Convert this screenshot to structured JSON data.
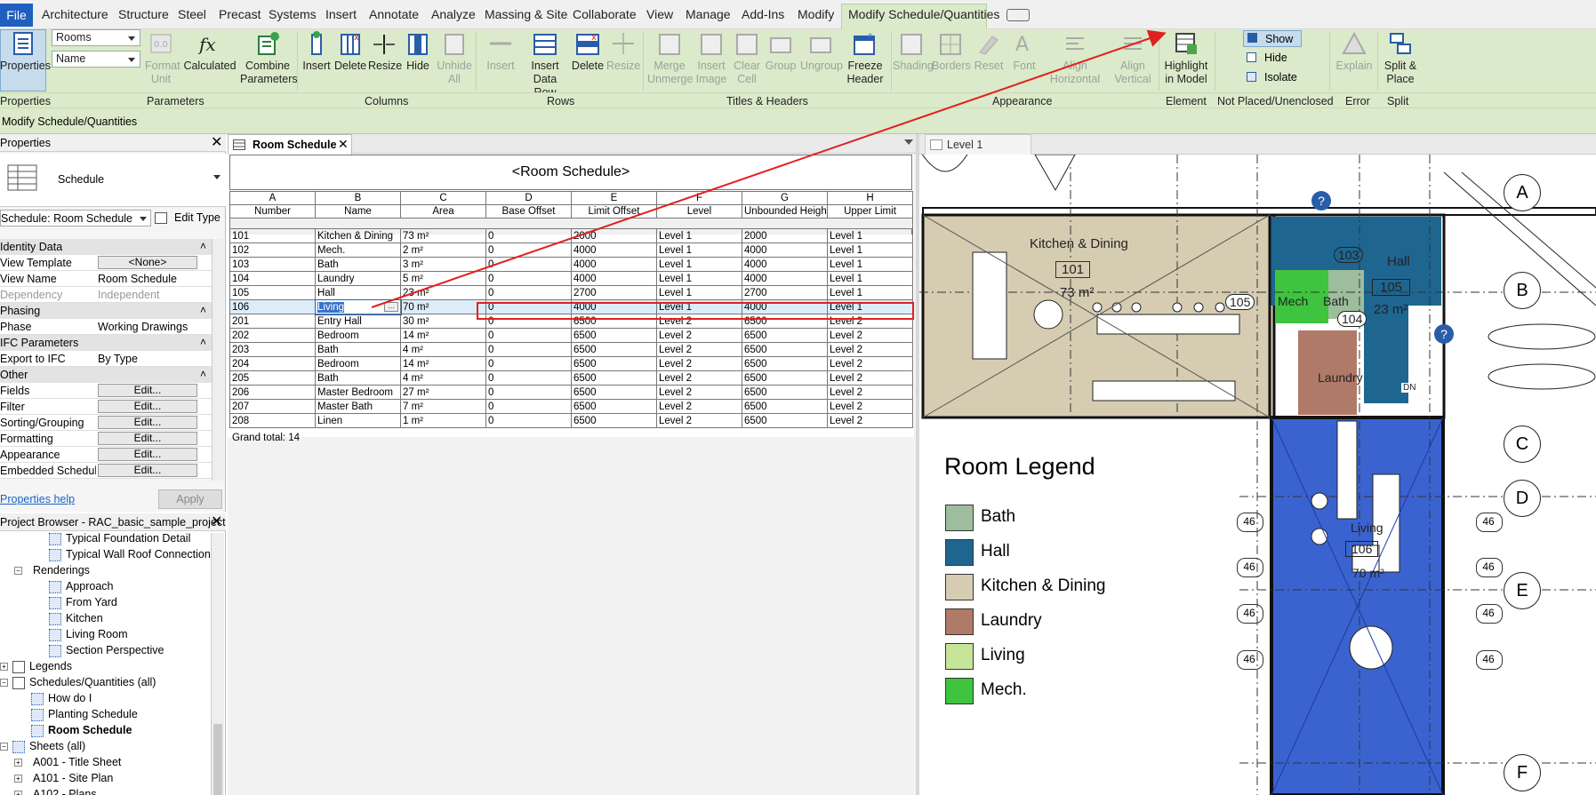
{
  "ribbon": {
    "tabs": [
      "File",
      "Architecture",
      "Structure",
      "Steel",
      "Precast",
      "Systems",
      "Insert",
      "Annotate",
      "Analyze",
      "Massing & Site",
      "Collaborate",
      "View",
      "Manage",
      "Add-Ins",
      "Modify",
      "Modify Schedule/Quantities"
    ],
    "active_tab": "Modify Schedule/Quantities",
    "category_combo": "Rooms",
    "field_combo": "Name",
    "buttons": {
      "properties": "Properties",
      "format_unit": "Format Unit",
      "calculated": "Calculated",
      "combine_parameters": "Combine Parameters",
      "insert_col": "Insert",
      "delete_col": "Delete",
      "resize_col": "Resize",
      "hide_col": "Hide",
      "unhide_all": "Unhide All",
      "insert_row": "Insert",
      "insert_data_row": "Insert Data Row",
      "delete_row": "Delete",
      "resize_row": "Resize",
      "merge_unmerge": "Merge Unmerge",
      "insert_image": "Insert Image",
      "clear_cell": "Clear Cell",
      "group": "Group",
      "ungroup": "Ungroup",
      "freeze_header": "Freeze Header",
      "shading": "Shading",
      "borders": "Borders",
      "reset": "Reset",
      "font": "Font",
      "align_horizontal": "Align Horizontal",
      "align_vertical": "Align Vertical",
      "highlight_in_model": "Highlight in Model",
      "show": "Show",
      "hide": "Hide",
      "isolate": "Isolate",
      "explain": "Explain",
      "split_place": "Split & Place"
    },
    "panels": [
      "Properties",
      "Parameters",
      "Columns",
      "Rows",
      "Titles & Headers",
      "Appearance",
      "Element",
      "Not Placed/Unenclosed",
      "Error",
      "Split"
    ]
  },
  "options_bar": "Modify Schedule/Quantities",
  "properties": {
    "title": "Properties",
    "type_name": "Schedule",
    "instance_selector": "Schedule: Room Schedule",
    "edit_type": "Edit Type",
    "groups": {
      "identity": "Identity Data",
      "phasing": "Phasing",
      "ifc": "IFC Parameters",
      "other": "Other"
    },
    "rows": {
      "view_template": {
        "k": "View Template",
        "v": "<None>"
      },
      "view_name": {
        "k": "View Name",
        "v": "Room Schedule"
      },
      "dependency": {
        "k": "Dependency",
        "v": "Independent"
      },
      "phase": {
        "k": "Phase",
        "v": "Working Drawings"
      },
      "export_ifc": {
        "k": "Export to IFC",
        "v": "By Type"
      },
      "fields": {
        "k": "Fields",
        "v": "Edit..."
      },
      "filter": {
        "k": "Filter",
        "v": "Edit..."
      },
      "sorting": {
        "k": "Sorting/Grouping",
        "v": "Edit..."
      },
      "formatting": {
        "k": "Formatting",
        "v": "Edit..."
      },
      "appearance": {
        "k": "Appearance",
        "v": "Edit..."
      },
      "embedded": {
        "k": "Embedded Schedule",
        "v": "Edit..."
      }
    },
    "help_link": "Properties help",
    "apply": "Apply"
  },
  "browser": {
    "title": "Project Browser - RAC_basic_sample_project",
    "items": [
      "Typical Foundation Detail",
      "Typical Wall Roof Connection",
      "Renderings",
      "Approach",
      "From Yard",
      "Kitchen",
      "Living Room",
      "Section Perspective",
      "Legends",
      "Schedules/Quantities (all)",
      "How do I",
      "Planting Schedule",
      "Room Schedule",
      "Sheets (all)",
      "A001 - Title Sheet",
      "A101 - Site Plan",
      "A102 - Plans"
    ]
  },
  "schedule": {
    "tab": "Room Schedule",
    "title": "<Room Schedule>",
    "col_letters": [
      "A",
      "B",
      "C",
      "D",
      "E",
      "F",
      "G",
      "H"
    ],
    "headers": [
      "Number",
      "Name",
      "Area",
      "Base Offset",
      "Limit Offset",
      "Level",
      "Unbounded Height",
      "Upper Limit"
    ],
    "rows": [
      [
        "101",
        "Kitchen & Dining",
        "73 m²",
        "0",
        "2000",
        "Level 1",
        "2000",
        "Level 1"
      ],
      [
        "102",
        "Mech.",
        "2 m²",
        "0",
        "4000",
        "Level 1",
        "4000",
        "Level 1"
      ],
      [
        "103",
        "Bath",
        "3 m²",
        "0",
        "4000",
        "Level 1",
        "4000",
        "Level 1"
      ],
      [
        "104",
        "Laundry",
        "5 m²",
        "0",
        "4000",
        "Level 1",
        "4000",
        "Level 1"
      ],
      [
        "105",
        "Hall",
        "23 m²",
        "0",
        "2700",
        "Level 1",
        "2700",
        "Level 1"
      ],
      [
        "106",
        "Living",
        "70 m²",
        "0",
        "4000",
        "Level 1",
        "4000",
        "Level 1"
      ],
      [
        "201",
        "Entry Hall",
        "30 m²",
        "0",
        "6500",
        "Level 2",
        "6500",
        "Level 2"
      ],
      [
        "202",
        "Bedroom",
        "14 m²",
        "0",
        "6500",
        "Level 2",
        "6500",
        "Level 2"
      ],
      [
        "203",
        "Bath",
        "4 m²",
        "0",
        "6500",
        "Level 2",
        "6500",
        "Level 2"
      ],
      [
        "204",
        "Bedroom",
        "14 m²",
        "0",
        "6500",
        "Level 2",
        "6500",
        "Level 2"
      ],
      [
        "205",
        "Bath",
        "4 m²",
        "0",
        "6500",
        "Level 2",
        "6500",
        "Level 2"
      ],
      [
        "206",
        "Master Bedroom",
        "27 m²",
        "0",
        "6500",
        "Level 2",
        "6500",
        "Level 2"
      ],
      [
        "207",
        "Master Bath",
        "7 m²",
        "0",
        "6500",
        "Level 2",
        "6500",
        "Level 2"
      ],
      [
        "208",
        "Linen",
        "1 m²",
        "0",
        "6500",
        "Level 2",
        "6500",
        "Level 2"
      ]
    ],
    "selected_row": 5,
    "grand_total": "Grand total: 14"
  },
  "plan": {
    "tab": "Level 1",
    "legend_title": "Room Legend",
    "legend": [
      {
        "name": "Bath",
        "color": "#9dbd9d"
      },
      {
        "name": "Hall",
        "color": "#1e6690"
      },
      {
        "name": "Kitchen & Dining",
        "color": "#d6ccb2"
      },
      {
        "name": "Laundry",
        "color": "#b07a68"
      },
      {
        "name": "Living",
        "color": "#c6e49a"
      },
      {
        "name": "Mech.",
        "color": "#3ec43e"
      }
    ],
    "grid_labels": [
      "A",
      "B",
      "C",
      "D",
      "E",
      "F"
    ],
    "tags": {
      "kitchen_name": "Kitchen & Dining",
      "kitchen_num": "101",
      "kitchen_area": "73 m²",
      "hall_name": "Hall",
      "hall_num": "105",
      "hall_area": "23 m²",
      "mech": "Mech",
      "bath": "Bath",
      "laundry": "Laundry",
      "n103": "103",
      "n104": "104",
      "n105": "105",
      "living_name": "Living",
      "living_num": "106",
      "living_area": "70 m²",
      "dn": "DN",
      "elev": "46",
      "help": "?"
    }
  },
  "colors": {
    "ribbon_bg": "#dbeaca",
    "file_tab": "#1f5fbf",
    "annotation": "#e02020",
    "living_blue": "#3b63cf"
  }
}
